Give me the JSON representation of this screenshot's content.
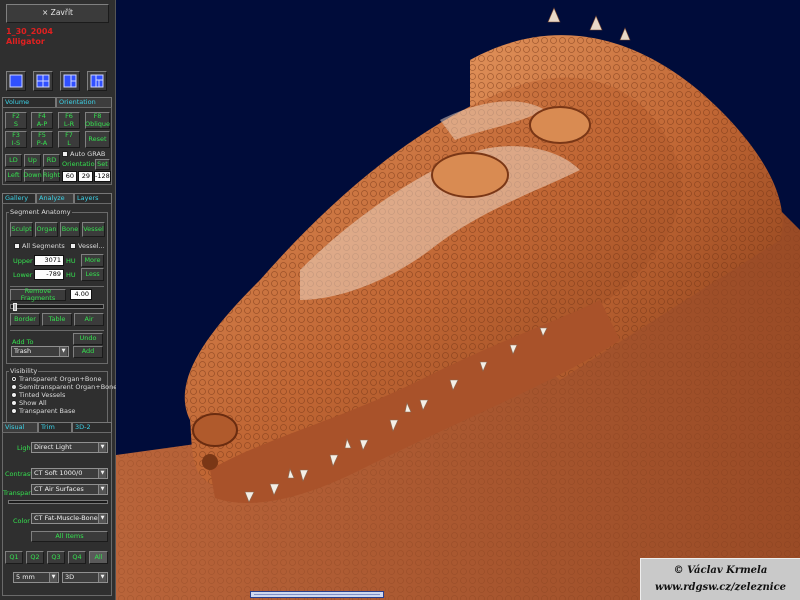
{
  "close_button": "×       Zavřít",
  "study": {
    "date": "1_30_2004",
    "name": "Alligator"
  },
  "layout_icons": [
    "single-view-icon",
    "quad-view-icon",
    "three-view-icon",
    "four-view-alt-icon"
  ],
  "tabs_top": [
    "Volume",
    "Orientation"
  ],
  "orientation_buttons": [
    {
      "key": "F2",
      "label": "S"
    },
    {
      "key": "F4",
      "label": "A-P"
    },
    {
      "key": "F6",
      "label": "L-R"
    },
    {
      "key": "F8",
      "label": "Oblique"
    },
    {
      "key": "F3",
      "label": "I-S"
    },
    {
      "key": "F5",
      "label": "P-A"
    },
    {
      "key": "F7",
      "label": "L"
    },
    {
      "key": "",
      "label": "Reset"
    }
  ],
  "auto_grab": "Auto GRAB",
  "orientation_label": "Orientation",
  "set_button": "Set",
  "move_buttons": [
    "LD",
    "Up",
    "RD",
    "Left",
    "Down",
    "Right"
  ],
  "orientation_values": [
    "60",
    "29",
    "-128"
  ],
  "tabs_mid": [
    "Gallery",
    "Analyze",
    "Layers"
  ],
  "segment_anatomy": {
    "title": "Segment Anatomy",
    "buttons": [
      "Sculpt",
      "Organ",
      "Bone",
      "Vessel"
    ],
    "all_segments": "All Segments",
    "vessel_check": "Vessel...",
    "upper_label": "Upper",
    "upper_value": "3071",
    "upper_unit": "HU",
    "more_button": "More",
    "lower_label": "Lower",
    "lower_value": "-789",
    "lower_unit": "HU",
    "less_button": "Less",
    "remove_fragments": "Remove Fragments",
    "fragments_value": "4.00",
    "tool_buttons": [
      "Border",
      "Table",
      "Air"
    ],
    "undo_button": "Undo",
    "add_to_label": "Add To",
    "add_to_value": "Trash",
    "add_button": "Add"
  },
  "visibility": {
    "title": "Visibility",
    "options": [
      "Transparent Organ+Bone",
      "Semitransparent Organ+Bone",
      "Tinted Vessels",
      "Show All",
      "Transparent Base"
    ],
    "selected": 0
  },
  "tabs_bottom": [
    "Visual",
    "Trim",
    "3D-2"
  ],
  "visual": {
    "light_label": "Light",
    "light_value": "Direct Light",
    "contrast_label": "Contrast",
    "contrast_value": "CT Soft 1000/0",
    "transpar_label": "Transpar.",
    "transpar_value": "CT Air Surfaces",
    "color_label": "Color",
    "color_value": "CT Fat-Muscle-Bone",
    "all_items_button": "All Items",
    "quadrant_buttons": [
      "Q1",
      "Q2",
      "Q3",
      "Q4",
      "All"
    ],
    "slab_value": "5 mm",
    "mode_value": "3D"
  },
  "credit": {
    "line1": "© Václav Krmela",
    "line2": "www.rdgsw.cz/zeleznice"
  },
  "colors": {
    "viewport_bg": "#000c3a",
    "skin": "#c8703c",
    "accent_green": "#35e14f",
    "accent_cyan": "#3bd1e6",
    "title_red": "#e02020"
  }
}
